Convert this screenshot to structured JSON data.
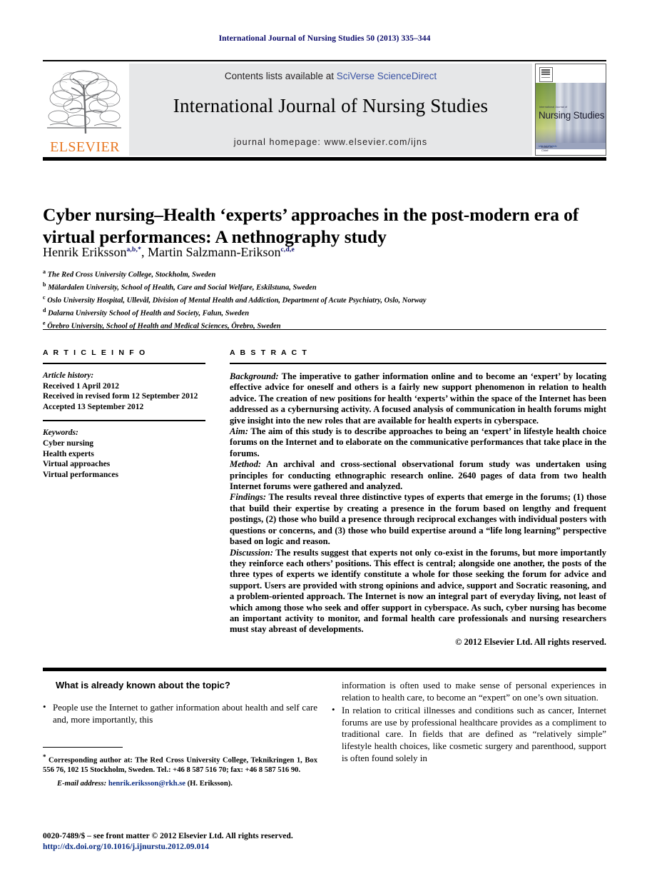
{
  "running_head": "International Journal of Nursing Studies 50 (2013) 335–344",
  "masthead": {
    "contents_prefix": "Contents lists available at ",
    "contents_link": "SciVerse ScienceDirect",
    "journal_title": "International Journal of Nursing Studies",
    "homepage": "journal homepage: www.elsevier.com/ijns",
    "publisher_wordmark": "ELSEVIER",
    "cover": {
      "kicker": "International Journal of",
      "name": "Nursing Studies",
      "strip_left": "Editor-in-Chief:",
      "strip_link": "IAN NORMAN"
    }
  },
  "article": {
    "title": "Cyber nursing–Health ‘experts’ approaches in the post-modern era of virtual performances: A nethnography study",
    "authors": [
      {
        "name": "Henrik Eriksson",
        "marks": "a,b,*"
      },
      {
        "name": "Martin Salzmann-Erikson",
        "marks": "c,d,e"
      }
    ],
    "affiliations": [
      {
        "mark": "a",
        "text": "The Red Cross University College, Stockholm, Sweden"
      },
      {
        "mark": "b",
        "text": "Mälardalen University, School of Health, Care and Social Welfare, Eskilstuna, Sweden"
      },
      {
        "mark": "c",
        "text": "Oslo University Hospital, Ullevål, Division of Mental Health and Addiction, Department of Acute Psychiatry, Oslo, Norway"
      },
      {
        "mark": "d",
        "text": "Dalarna University School of Health and Society, Falun, Sweden"
      },
      {
        "mark": "e",
        "text": "Örebro University, School of Health and Medical Sciences, Örebro, Sweden"
      }
    ]
  },
  "article_info": {
    "heading": "A R T I C L E   I N F O",
    "history_label": "Article history:",
    "history": [
      "Received 1 April 2012",
      "Received in revised form 12 September 2012",
      "Accepted 13 September 2012"
    ],
    "keywords_label": "Keywords:",
    "keywords": [
      "Cyber nursing",
      "Health experts",
      "Virtual approaches",
      "Virtual performances"
    ]
  },
  "abstract": {
    "heading": "A B S T R A C T",
    "sections": [
      {
        "label": "Background:",
        "text": " The imperative to gather information online and to become an ‘expert’ by locating effective advice for oneself and others is a fairly new support phenomenon in relation to health advice. The creation of new positions for health ‘experts’ within the space of the Internet has been addressed as a cybernursing activity. A focused analysis of communication in health forums might give insight into the new roles that are available for health experts in cyberspace."
      },
      {
        "label": "Aim:",
        "text": " The aim of this study is to describe approaches to being an ‘expert’ in lifestyle health choice forums on the Internet and to elaborate on the communicative performances that take place in the forums."
      },
      {
        "label": "Method:",
        "text": " An archival and cross-sectional observational forum study was undertaken using principles for conducting ethnographic research online. 2640 pages of data from two health Internet forums were gathered and analyzed."
      },
      {
        "label": "Findings:",
        "text": " The results reveal three distinctive types of experts that emerge in the forums; (1) those that build their expertise by creating a presence in the forum based on lengthy and frequent postings, (2) those who build a presence through reciprocal exchanges with individual posters with questions or concerns, and (3) those who build expertise around a “life long learning” perspective based on logic and reason."
      },
      {
        "label": "Discussion:",
        "text": " The results suggest that experts not only co-exist in the forums, but more importantly they reinforce each others’ positions. This effect is central; alongside one another, the posts of the three types of experts we identify constitute a whole for those seeking the forum for advice and support. Users are provided with strong opinions and advice, support and Socratic reasoning, and a problem-oriented approach. The Internet is now an integral part of everyday living, not least of which among those who seek and offer support in cyberspace. As such, cyber nursing has become an important activity to monitor, and formal health care professionals and nursing researchers must stay abreast of developments."
      }
    ],
    "copyright": "© 2012 Elsevier Ltd. All rights reserved."
  },
  "highlights": {
    "title": "What is already known about the topic?",
    "bullets": [
      "People use the Internet to gather information about health and self care and, more importantly, this",
      "In relation to critical illnesses and conditions such as cancer, Internet forums are use by professional healthcare provides as a compliment to traditional care. In fields that are defined as “relatively simple” lifestyle health choices, like cosmetic surgery and parenthood, support is often found solely in"
    ],
    "continuation": "information is often used to make sense of personal experiences in relation to health care, to become an “expert” on one’s own situation."
  },
  "footnotes": {
    "corresponding": "Corresponding author at: The Red Cross University College, Teknikringen 1, Box 556 76, 102 15 Stockholm, Sweden. Tel.: +46 8 587 516 70; fax: +46 8 587 516 90.",
    "email_label": "E-mail address:",
    "email": "henrik.eriksson@rkh.se",
    "email_suffix": " (H. Eriksson).",
    "issn_line": "0020-7489/$ – see front matter © 2012 Elsevier Ltd. All rights reserved.",
    "doi": "http://dx.doi.org/10.1016/j.ijnurstu.2012.09.014"
  },
  "colors": {
    "elsevier_orange": "#E87722",
    "link_blue": "#0b2d83",
    "sciencedirect_blue": "#3a53a4",
    "banner_grey": "#e6e7e8",
    "running_head_navy": "#0b0b6b"
  }
}
